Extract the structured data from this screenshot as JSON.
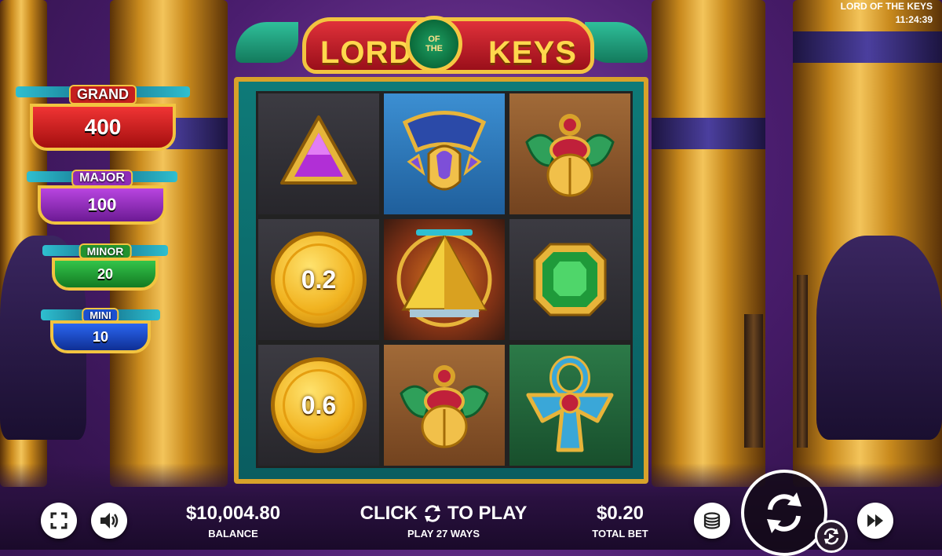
{
  "game": {
    "title": "LORD OF THE KEYS",
    "clock": "11:24:39",
    "logo": {
      "word1": "LORD",
      "word_of": "OF",
      "word_the": "THE",
      "word2": "KEYS"
    }
  },
  "jackpots": [
    {
      "name": "GRAND",
      "value": "400",
      "color": "#e02a2a"
    },
    {
      "name": "MAJOR",
      "value": "100",
      "color": "#9b2fc6"
    },
    {
      "name": "MINOR",
      "value": "20",
      "color": "#27a83a"
    },
    {
      "name": "MINI",
      "value": "10",
      "color": "#1b4fd0"
    }
  ],
  "reels": {
    "rows": [
      [
        {
          "symbol": "purple-triangle-gem-icon",
          "tile": "dark"
        },
        {
          "symbol": "blue-lotus-crown-icon",
          "tile": "blue"
        },
        {
          "symbol": "golden-scarab-icon",
          "tile": "brown"
        }
      ],
      [
        {
          "symbol": "coin",
          "tile": "dark",
          "value": "0.2"
        },
        {
          "symbol": "golden-pyramid-icon",
          "tile": "glow"
        },
        {
          "symbol": "green-emerald-gem-icon",
          "tile": "dark"
        }
      ],
      [
        {
          "symbol": "coin",
          "tile": "dark",
          "value": "0.6"
        },
        {
          "symbol": "golden-scarab-icon",
          "tile": "brown"
        },
        {
          "symbol": "blue-ankh-icon",
          "tile": "green"
        }
      ]
    ]
  },
  "footer": {
    "balance_value": "$10,004.80",
    "balance_label": "BALANCE",
    "play_prefix": "CLICK",
    "play_suffix": "TO PLAY",
    "ways_label": "PLAY 27 WAYS",
    "total_bet_value": "$0.20",
    "total_bet_label": "TOTAL BET"
  },
  "colors": {
    "gold": "#f2c440",
    "frame_teal": "#0e7a78",
    "logo_red": "#c71f2b"
  }
}
